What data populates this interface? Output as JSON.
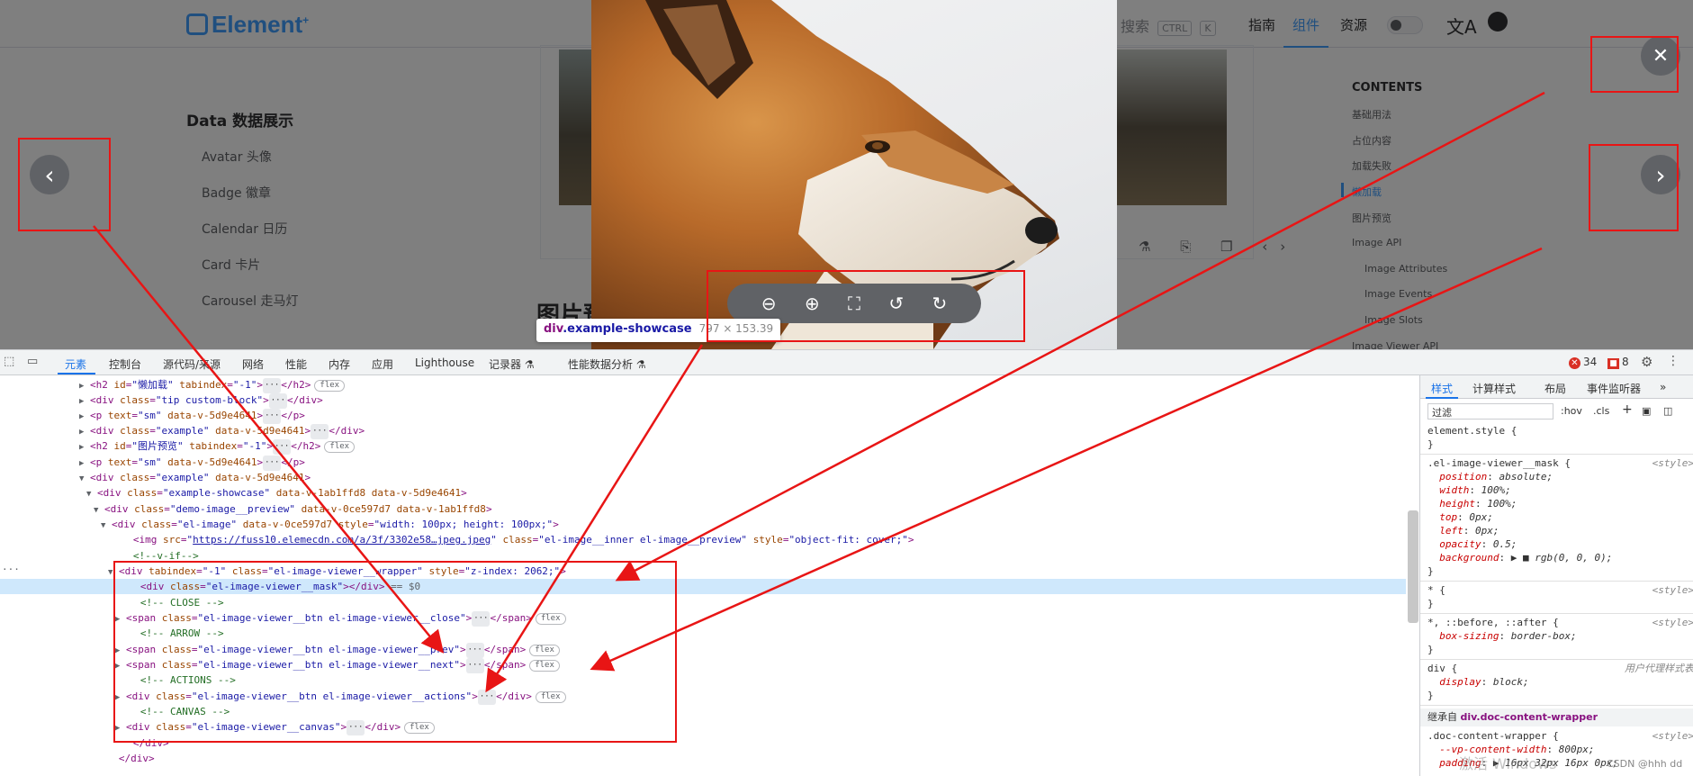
{
  "site": {
    "logo": "Element",
    "logo_sup": "+",
    "search_placeholder": "搜索",
    "search_kbd1": "CTRL",
    "search_kbd2": "K",
    "nav": [
      "指南",
      "组件",
      "资源"
    ],
    "nav_active": "组件",
    "translate_icon": "translate-icon",
    "github_icon": "github-icon"
  },
  "sidebar": {
    "group_title": "Data 数据展示",
    "items": [
      "Avatar 头像",
      "Badge 徽章",
      "Calendar 日历",
      "Card 卡片",
      "Carousel 走马灯"
    ]
  },
  "main": {
    "section_title": "图片预览",
    "card_tools": "⚗ ⎘ ❐ ‹›"
  },
  "toc": {
    "title": "CONTENTS",
    "items": [
      "基础用法",
      "占位内容",
      "加载失败",
      "懒加载",
      "图片预览",
      "Image API",
      "Image Attributes",
      "Image Events",
      "Image Slots",
      "Image Viewer API"
    ],
    "active": "懒加载"
  },
  "viewer": {
    "close_icon": "✕",
    "prev_icon": "‹",
    "next_icon": "›",
    "actions": [
      "zoom-out-icon",
      "zoom-in-icon",
      "fullscreen-icon",
      "rotate-left-icon",
      "rotate-right-icon"
    ]
  },
  "inspect_tip": {
    "tag": "div",
    "cls": ".example-showcase",
    "dims": "797 × 153.39"
  },
  "devtools": {
    "tabs": [
      "元素",
      "控制台",
      "源代码/来源",
      "网络",
      "性能",
      "内存",
      "应用",
      "Lighthouse",
      "记录器 ⚗",
      "性能数据分析 ⚗"
    ],
    "active_tab": "元素",
    "error_count": "34",
    "warn_count": "8",
    "styles_tabs": [
      "样式",
      "计算样式",
      "布局",
      "事件监听器",
      "»"
    ],
    "filter_placeholder": "过滤",
    "hov": ":hov",
    "cls": ".cls"
  },
  "dom_lines": [
    {
      "indent": 11,
      "arrow": "▶",
      "html": "<span class='t'>&lt;h2 </span><span class='a'>id</span>=<span class='v'>\"懒加载\"</span> <span class='a'>tabindex</span>=<span class='v'>\"-1\"</span><span class='t'>&gt;</span><span class='ell'>···</span><span class='t'>&lt;/h2&gt;</span><span class='flexb'>flex</span>"
    },
    {
      "indent": 11,
      "arrow": "▶",
      "html": "<span class='t'>&lt;div </span><span class='a'>class</span>=<span class='v'>\"tip custom-block\"</span><span class='t'>&gt;</span><span class='ell'>···</span><span class='t'>&lt;/div&gt;</span>"
    },
    {
      "indent": 11,
      "arrow": "▶",
      "html": "<span class='t'>&lt;p </span><span class='a'>text</span>=<span class='v'>\"sm\"</span> <span class='a'>data-v-5d9e4641</span><span class='t'>&gt;</span><span class='ell'>···</span><span class='t'>&lt;/p&gt;</span>"
    },
    {
      "indent": 11,
      "arrow": "▶",
      "html": "<span class='t'>&lt;div </span><span class='a'>class</span>=<span class='v'>\"example\"</span> <span class='a'>data-v-5d9e4641</span><span class='t'>&gt;</span><span class='ell'>···</span><span class='t'>&lt;/div&gt;</span>"
    },
    {
      "indent": 11,
      "arrow": "▶",
      "html": "<span class='t'>&lt;h2 </span><span class='a'>id</span>=<span class='v'>\"图片预览\"</span> <span class='a'>tabindex</span>=<span class='v'>\"-1\"</span><span class='t'>&gt;</span><span class='ell'>···</span><span class='t'>&lt;/h2&gt;</span><span class='flexb'>flex</span>"
    },
    {
      "indent": 11,
      "arrow": "▶",
      "html": "<span class='t'>&lt;p </span><span class='a'>text</span>=<span class='v'>\"sm\"</span> <span class='a'>data-v-5d9e4641</span><span class='t'>&gt;</span><span class='ell'>···</span><span class='t'>&lt;/p&gt;</span>"
    },
    {
      "indent": 11,
      "arrow": "▼",
      "html": "<span class='t'>&lt;div </span><span class='a'>class</span>=<span class='v'>\"example\"</span> <span class='a'>data-v-5d9e4641</span><span class='t'>&gt;</span>"
    },
    {
      "indent": 12,
      "arrow": "▼",
      "html": "<span class='t'>&lt;div </span><span class='a'>class</span>=<span class='v'>\"example-showcase\"</span> <span class='a'>data-v-1ab1ffd8 data-v-5d9e4641</span><span class='t'>&gt;</span>"
    },
    {
      "indent": 13,
      "arrow": "▼",
      "html": "<span class='t'>&lt;div </span><span class='a'>class</span>=<span class='v'>\"demo-image__preview\"</span> <span class='a'>data-v-0ce597d7 data-v-1ab1ffd8</span><span class='t'>&gt;</span>"
    },
    {
      "indent": 14,
      "arrow": "▼",
      "html": "<span class='t'>&lt;div </span><span class='a'>class</span>=<span class='v'>\"el-image\"</span> <span class='a'>data-v-0ce597d7</span> <span class='a'>style</span>=<span class='v'>\"width: 100px; height: 100px;\"</span><span class='t'>&gt;</span>"
    },
    {
      "indent": 16,
      "arrow": "",
      "html": "<span class='t'>&lt;img </span><span class='a'>src</span>=<span class='v'>\"</span><span class='lk'>https://fuss10.elemecdn.com/a/3f/3302e58…jpeg.jpeg</span><span class='v'>\"</span> <span class='a'>class</span>=<span class='v'>\"el-image__inner el-image__preview\"</span> <span class='a'>style</span>=<span class='v'>\"object-fit: cover;\"</span><span class='t'>&gt;</span>"
    },
    {
      "indent": 16,
      "arrow": "",
      "html": "<span class='c'>&lt;!--v-if--&gt;</span>"
    },
    {
      "indent": 15,
      "arrow": "▼",
      "html": "<span class='t'>&lt;div </span><span class='a'>tabindex</span>=<span class='v'>\"-1\"</span> <span class='a'>class</span>=<span class='v'>\"el-image-viewer__wrapper\"</span> <span class='a'>style</span>=<span class='v'>\"z-index: 2062;\"</span><span class='t'>&gt;</span>"
    },
    {
      "indent": 17,
      "arrow": "",
      "html": "<span class='t'>&lt;div </span><span class='a'>class</span>=<span class='v'>\"el-image-viewer__mask\"</span><span class='t'>&gt;&lt;/div&gt;</span> <span class='g'>== $0</span>",
      "sel": true
    },
    {
      "indent": 17,
      "arrow": "",
      "html": "<span class='c'>&lt;!-- CLOSE --&gt;</span>"
    },
    {
      "indent": 16,
      "arrow": "▶",
      "html": "<span class='t'>&lt;span </span><span class='a'>class</span>=<span class='v'>\"el-image-viewer__btn el-image-viewer__close\"</span><span class='t'>&gt;</span><span class='ell'>···</span><span class='t'>&lt;/span&gt;</span><span class='flexb'>flex</span>"
    },
    {
      "indent": 17,
      "arrow": "",
      "html": "<span class='c'>&lt;!-- ARROW --&gt;</span>"
    },
    {
      "indent": 16,
      "arrow": "▶",
      "html": "<span class='t'>&lt;span </span><span class='a'>class</span>=<span class='v'>\"el-image-viewer__btn el-image-viewer__prev\"</span><span class='t'>&gt;</span><span class='ell'>···</span><span class='t'>&lt;/span&gt;</span><span class='flexb'>flex</span>"
    },
    {
      "indent": 16,
      "arrow": "▶",
      "html": "<span class='t'>&lt;span </span><span class='a'>class</span>=<span class='v'>\"el-image-viewer__btn el-image-viewer__next\"</span><span class='t'>&gt;</span><span class='ell'>···</span><span class='t'>&lt;/span&gt;</span><span class='flexb'>flex</span>"
    },
    {
      "indent": 17,
      "arrow": "",
      "html": "<span class='c'>&lt;!-- ACTIONS --&gt;</span>"
    },
    {
      "indent": 16,
      "arrow": "▶",
      "html": "<span class='t'>&lt;div </span><span class='a'>class</span>=<span class='v'>\"el-image-viewer__btn el-image-viewer__actions\"</span><span class='t'>&gt;</span><span class='ell'>···</span><span class='t'>&lt;/div&gt;</span><span class='flexb'>flex</span>"
    },
    {
      "indent": 17,
      "arrow": "",
      "html": "<span class='c'>&lt;!-- CANVAS --&gt;</span>"
    },
    {
      "indent": 16,
      "arrow": "▶",
      "html": "<span class='t'>&lt;div </span><span class='a'>class</span>=<span class='v'>\"el-image-viewer__canvas\"</span><span class='t'>&gt;</span><span class='ell'>···</span><span class='t'>&lt;/div&gt;</span><span class='flexb'>flex</span>"
    },
    {
      "indent": 16,
      "arrow": "",
      "html": "<span class='t'>&lt;/div&gt;</span>"
    },
    {
      "indent": 14,
      "arrow": "",
      "html": "<span class='t'>&lt;/div&gt;</span>"
    }
  ],
  "styles": {
    "rules": [
      {
        "sel": "element.style {",
        "props": [],
        "src": ""
      },
      {
        "sel": ".el-image-viewer__mask {",
        "src": "<style>",
        "props": [
          [
            "position",
            "absolute;"
          ],
          [
            "width",
            "100%;"
          ],
          [
            "height",
            "100%;"
          ],
          [
            "top",
            "0px;"
          ],
          [
            "left",
            "0px;"
          ],
          [
            "opacity",
            "0.5;"
          ],
          [
            "background",
            "▶ ■ rgb(0, 0, 0);"
          ]
        ]
      },
      {
        "sel": "* {",
        "src": "<style>",
        "props": []
      },
      {
        "sel": "*, ::before, ::after {",
        "src": "<style>",
        "props": [
          [
            "box-sizing",
            "border-box;"
          ]
        ]
      },
      {
        "sel": "div {",
        "src": "用户代理样式表",
        "props": [
          [
            "display",
            "block;"
          ]
        ]
      }
    ],
    "inherited_label": "继承自",
    "inherited_from": "div.doc-content-wrapper",
    "last_rule": ".doc-content-wrapper {",
    "last_rule_src": "<style>",
    "last_props": [
      [
        "--vp-content-width",
        "800px;"
      ],
      [
        "padding",
        "▶ 16px 32px 16px 0px;"
      ]
    ]
  },
  "watermark": "激活 Windows",
  "credit": "CSDN @hhh dd"
}
